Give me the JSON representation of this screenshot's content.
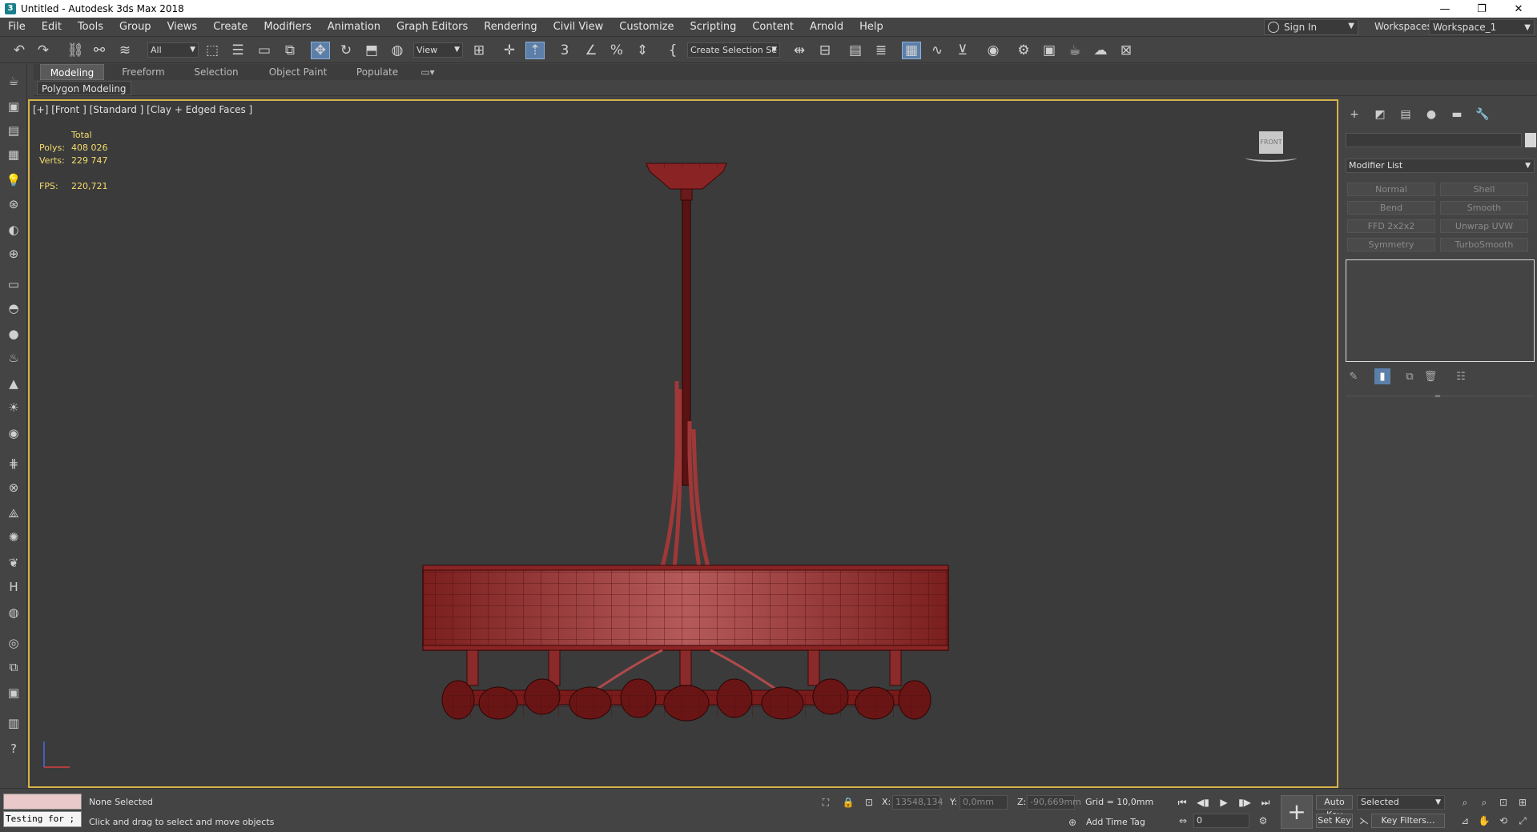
{
  "window": {
    "title": "Untitled - Autodesk 3ds Max 2018",
    "minimize": "—",
    "restore": "❐",
    "close": "✕"
  },
  "menu": {
    "items": [
      "File",
      "Edit",
      "Tools",
      "Group",
      "Views",
      "Create",
      "Modifiers",
      "Animation",
      "Graph Editors",
      "Rendering",
      "Civil View",
      "Customize",
      "Scripting",
      "Content",
      "Arnold",
      "Help"
    ],
    "sign_in": "Sign In",
    "workspaces_label": "Workspaces:",
    "workspace_value": "Workspace_1"
  },
  "toolbar": {
    "selection_filter": "All",
    "reference_coord": "View",
    "named_selection": "Create Selection Se"
  },
  "ribbon": {
    "tabs": [
      "Modeling",
      "Freeform",
      "Selection",
      "Object Paint",
      "Populate"
    ],
    "active_tab": "Modeling",
    "sub_label": "Polygon Modeling"
  },
  "viewport": {
    "label": "[+] [Front ] [Standard ] [Clay + Edged Faces ]",
    "stats": {
      "total_label": "Total",
      "polys_label": "Polys:",
      "polys_value": "408 026",
      "verts_label": "Verts:",
      "verts_value": "229 747",
      "fps_label": "FPS:",
      "fps_value": "220,721"
    },
    "viewcube_label": "FRONT"
  },
  "command_panel": {
    "modifier_list": "Modifier List",
    "modifiers": [
      "Normal",
      "Shell",
      "Bend",
      "Smooth",
      "FFD 2x2x2",
      "Unwrap UVW",
      "Symmetry",
      "TurboSmooth"
    ]
  },
  "status": {
    "maxscript_input": "Testing for ;",
    "selection_status": "None Selected",
    "prompt": "Click and drag to select and move objects",
    "x_label": "X:",
    "x_value": "13548,134",
    "y_label": "Y:",
    "y_value": "0,0mm",
    "z_label": "Z:",
    "z_value": "-90,669mm",
    "grid": "Grid = 10,0mm",
    "add_time_tag": "Add Time Tag",
    "frame": "0",
    "auto_key": "Auto Key",
    "set_key": "Set Key",
    "selected": "Selected",
    "key_filters": "Key Filters..."
  },
  "colors": {
    "viewport_border": "#d6b24a",
    "stats_text": "#f4dc6e",
    "model_red": "#9a2a2a",
    "active_tool": "#5b7fa8"
  }
}
